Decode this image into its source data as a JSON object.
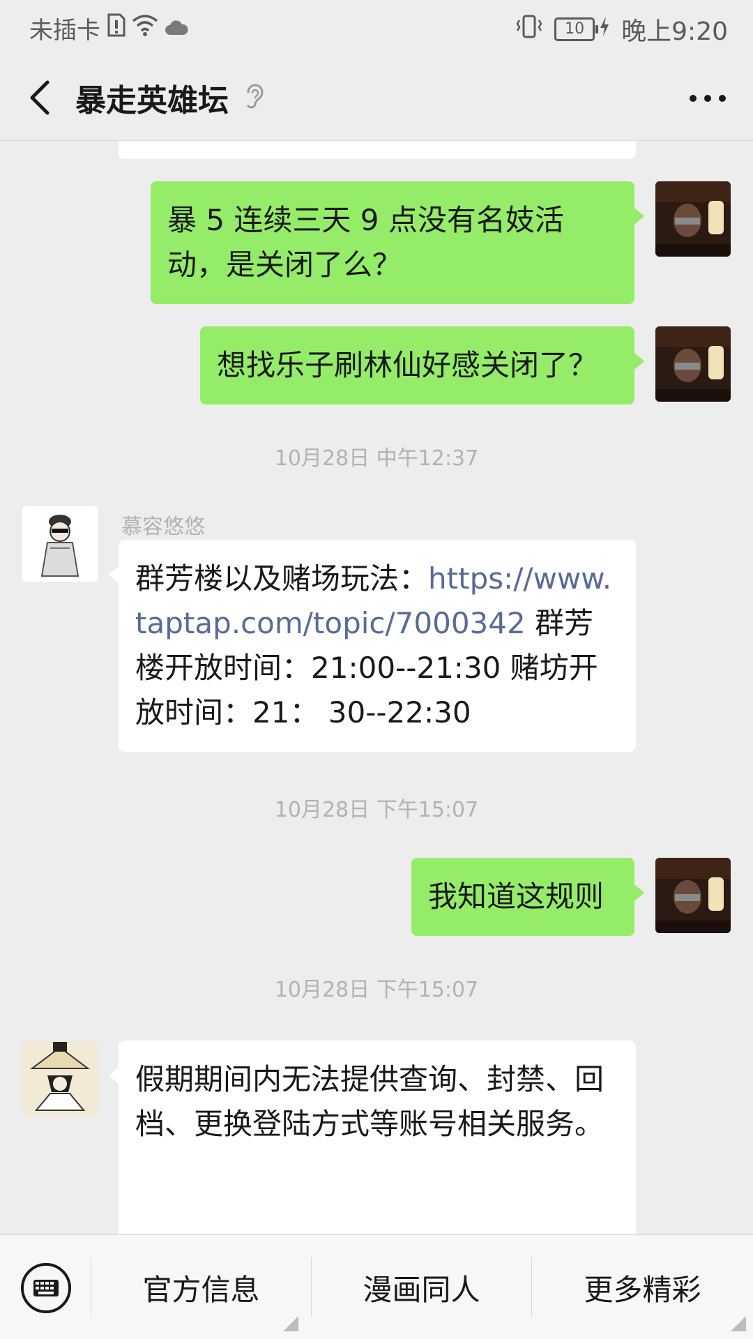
{
  "status_bar": {
    "carrier": "未插卡",
    "battery": "10",
    "time": "晚上9:20"
  },
  "header": {
    "title": "暴走英雄坛",
    "back_icon": "chevron-left-icon",
    "mute_icon": "ear-icon",
    "more_icon": "more-icon"
  },
  "messages": [
    {
      "side": "right",
      "text": "暴 5 连续三天 9 点没有名妓活动，是关闭了么？"
    },
    {
      "side": "right",
      "text": "想找乐子刷林仙好感关闭了？"
    },
    {
      "timestamp": "10月28日 中午12:37"
    },
    {
      "side": "left",
      "sender": "慕容悠悠",
      "text_before_link": "群芳楼以及赌场玩法：",
      "link": "https://www.taptap.com/topic/7000342",
      "text_after_link": " 群芳楼开放时间：21:00--21:30 赌坊开放时间：21： 30--22:30"
    },
    {
      "timestamp": "10月28日 下午15:07"
    },
    {
      "side": "right",
      "text": "我知道这规则"
    },
    {
      "timestamp": "10月28日 下午15:07"
    },
    {
      "side": "left",
      "text": "假期期间内无法提供查询、封禁、回档、更换登陆方式等账号相关服务。"
    }
  ],
  "bottom_menu": {
    "keyboard_icon": "keyboard-icon",
    "items": [
      "官方信息",
      "漫画同人",
      "更多精彩"
    ]
  },
  "colors": {
    "background": "#ededed",
    "sent_bubble": "#95ec69",
    "received_bubble": "#ffffff",
    "link": "#576b95"
  }
}
